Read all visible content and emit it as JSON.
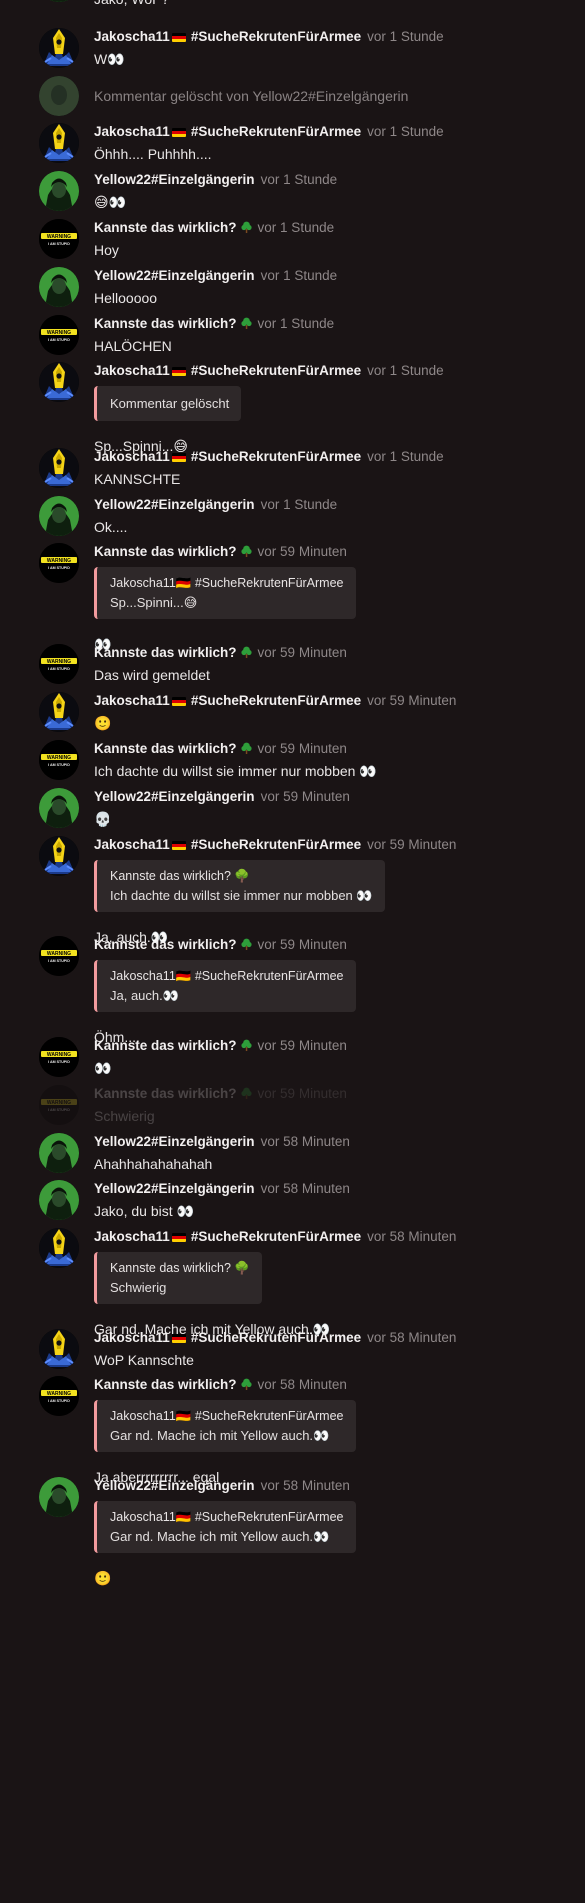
{
  "messages": [
    {
      "type": "partial",
      "text": "Jako, WoP?",
      "avatar": "yellow"
    },
    {
      "type": "msg",
      "user": "jakoscha",
      "time": "vor 1 Stunde",
      "text": "W👀"
    },
    {
      "type": "deleted",
      "text": "Kommentar gelöscht von Yellow22#Einzelgängerin"
    },
    {
      "type": "msg",
      "user": "jakoscha",
      "time": "vor 1 Stunde",
      "text": "Öhhh.... Puhhhh...."
    },
    {
      "type": "msg",
      "user": "yellow",
      "time": "vor 1 Stunde",
      "text": "😅👀"
    },
    {
      "type": "msg",
      "user": "kannste",
      "time": "vor 1 Stunde",
      "text": "Hoy"
    },
    {
      "type": "msg",
      "user": "yellow",
      "time": "vor 1 Stunde",
      "text": "Hellooooo"
    },
    {
      "type": "msg",
      "user": "kannste",
      "time": "vor 1 Stunde",
      "text": "HALÖCHEN"
    },
    {
      "type": "quote",
      "user": "jakoscha",
      "time": "vor 1 Stunde",
      "quote_deleted": "Kommentar gelöscht",
      "after": "Sp...Spinni...😅"
    },
    {
      "type": "msg",
      "user": "jakoscha",
      "time": "vor 1 Stunde",
      "text": "KANNSCHTE"
    },
    {
      "type": "msg",
      "user": "yellow",
      "time": "vor 1 Stunde",
      "text": "Ok...."
    },
    {
      "type": "quote",
      "user": "kannste",
      "time": "vor 59 Minuten",
      "quote_author": "Jakoscha11🇩🇪 #SucheRekrutenFürArmee",
      "quote_text": "Sp...Spinni...😅",
      "after": "👀"
    },
    {
      "type": "msg",
      "user": "kannste",
      "time": "vor 59 Minuten",
      "text": "Das wird gemeldet"
    },
    {
      "type": "msg",
      "user": "jakoscha",
      "time": "vor 59 Minuten",
      "text": "🙂"
    },
    {
      "type": "msg",
      "user": "kannste",
      "time": "vor 59 Minuten",
      "text": "Ich dachte du willst sie immer nur mobben 👀"
    },
    {
      "type": "msg",
      "user": "yellow",
      "time": "vor 59 Minuten",
      "text": "💀"
    },
    {
      "type": "quote",
      "user": "jakoscha",
      "time": "vor 59 Minuten",
      "quote_author": "Kannste das wirklich? 🌳",
      "quote_text": "Ich dachte du willst sie immer nur mobben 👀",
      "after": "Ja, auch.👀"
    },
    {
      "type": "quote",
      "user": "kannste",
      "time": "vor 59 Minuten",
      "quote_author": "Jakoscha11🇩🇪 #SucheRekrutenFürArmee",
      "quote_text": "Ja, auch.👀",
      "after": "Öhm...."
    },
    {
      "type": "msg",
      "user": "kannste",
      "time": "vor 59 Minuten",
      "text": "👀"
    },
    {
      "type": "msg",
      "user": "kannste",
      "time": "vor 59 Minuten",
      "text": "Schwierig",
      "faded": true
    },
    {
      "type": "msg",
      "user": "yellow",
      "time": "vor 58 Minuten",
      "text": "Ahahhahahahahah"
    },
    {
      "type": "msg",
      "user": "yellow",
      "time": "vor 58 Minuten",
      "text": "Jako, du bist 👀"
    },
    {
      "type": "quote",
      "user": "jakoscha",
      "time": "vor 58 Minuten",
      "quote_author": "Kannste das wirklich? 🌳",
      "quote_text": "Schwierig",
      "after": "Gar nd. Mache ich mit Yellow auch.👀"
    },
    {
      "type": "msg",
      "user": "jakoscha",
      "time": "vor 58 Minuten",
      "text": "WoP Kannschte"
    },
    {
      "type": "quote",
      "user": "kannste",
      "time": "vor 58 Minuten",
      "quote_author": "Jakoscha11🇩🇪 #SucheRekrutenFürArmee",
      "quote_text": "Gar nd. Mache ich mit Yellow auch.👀",
      "after": "Ja aberrrrrrrrr... egal"
    },
    {
      "type": "quote",
      "user": "yellow",
      "time": "vor 58 Minuten",
      "quote_author": "Jakoscha11🇩🇪 #SucheRekrutenFürArmee",
      "quote_text": "Gar nd. Mache ich mit Yellow auch.👀",
      "after": "🙂"
    }
  ],
  "users": {
    "jakoscha": {
      "name": "Jakoscha11",
      "flag": "de-flag-icon",
      "suffix": "#SucheRekrutenFürArmee",
      "avatar": "jakoscha-avatar"
    },
    "yellow": {
      "name": "Yellow22#Einzelgängerin",
      "avatar": "yellow-avatar"
    },
    "kannste": {
      "name": "Kannste das wirklich?",
      "badge": "tree-icon",
      "avatar": "warning-avatar",
      "avatar_text_1": "WARNING",
      "avatar_text_2": "I AM STUPID"
    }
  },
  "colors": {
    "background": "#1a1415",
    "quote_bg": "#2e2829",
    "quote_bar": "#f29b9e",
    "timestamp": "#8e8788"
  }
}
